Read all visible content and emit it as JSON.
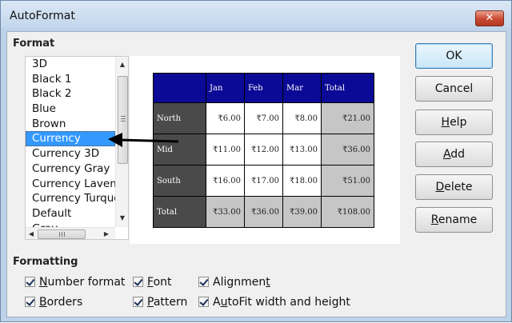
{
  "window": {
    "title": "AutoFormat",
    "close_glyph": "✕"
  },
  "format_section": {
    "label": "Format",
    "items": [
      "3D",
      "Black 1",
      "Black 2",
      "Blue",
      "Brown",
      "Currency",
      "Currency 3D",
      "Currency Gray",
      "Currency Lavend",
      "Currency Turquo",
      "Default",
      "Gray"
    ],
    "selected": "Currency"
  },
  "preview": {
    "headers": [
      "",
      "Jan",
      "Feb",
      "Mar",
      "Total"
    ],
    "rows": [
      {
        "label": "North",
        "values": [
          "₹6.00",
          "₹7.00",
          "₹8.00"
        ],
        "total": "₹21.00"
      },
      {
        "label": "Mid",
        "values": [
          "₹11.00",
          "₹12.00",
          "₹13.00"
        ],
        "total": "₹36.00"
      },
      {
        "label": "South",
        "values": [
          "₹16.00",
          "₹17.00",
          "₹18.00"
        ],
        "total": "₹51.00"
      },
      {
        "label": "Total",
        "values": [
          "₹33.00",
          "₹36.00",
          "₹39.00"
        ],
        "total": "₹108.00"
      }
    ]
  },
  "buttons": {
    "ok": "OK",
    "cancel": "Cancel",
    "help": {
      "mnemonic": "H",
      "rest": "elp"
    },
    "add": {
      "mnemonic": "A",
      "rest": "dd"
    },
    "delete": {
      "mnemonic": "D",
      "rest": "elete"
    },
    "rename": {
      "mnemonic": "R",
      "rest": "ename"
    }
  },
  "formatting_section": {
    "label": "Formatting",
    "checkboxes": {
      "number_format": {
        "mnemonic": "N",
        "rest": "umber format",
        "checked": true
      },
      "font": {
        "mnemonic": "F",
        "rest": "ont",
        "checked": true
      },
      "alignment": {
        "pre": "Alignmen",
        "mnemonic": "t",
        "checked": true
      },
      "borders": {
        "mnemonic": "B",
        "rest": "orders",
        "checked": true
      },
      "pattern": {
        "mnemonic": "P",
        "rest": "attern",
        "checked": true
      },
      "autofit": {
        "pre": "A",
        "mnemonic": "u",
        "rest": "toFit width and height",
        "checked": true
      }
    }
  },
  "colors": {
    "header_blue": "#0a0a96",
    "row_label_gray": "#4a4a4a",
    "total_gray": "#c6c6c6",
    "selection": "#3399ff"
  }
}
